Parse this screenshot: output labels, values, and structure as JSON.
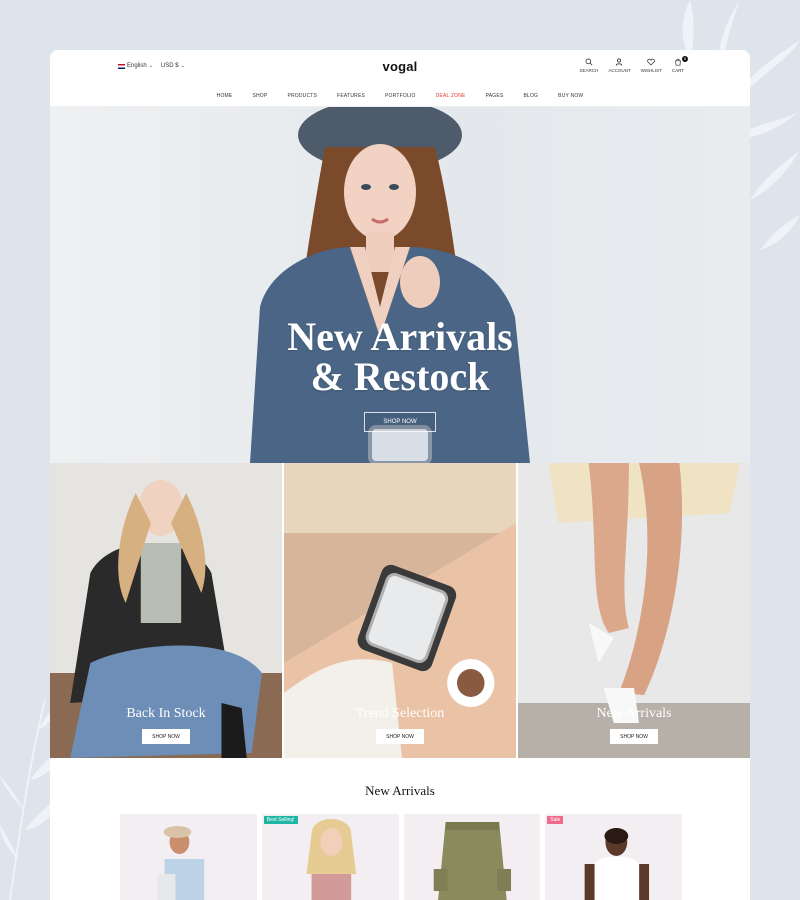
{
  "header": {
    "language": "English",
    "currency": "USD $",
    "logo": "vogal",
    "tools": [
      {
        "label": "SEARCH",
        "icon": "search-icon"
      },
      {
        "label": "ACCOUNT",
        "icon": "user-icon"
      },
      {
        "label": "WISHLIST",
        "icon": "heart-icon"
      },
      {
        "label": "CART",
        "icon": "cart-icon",
        "count": "0"
      }
    ]
  },
  "nav": {
    "items": [
      "HOME",
      "SHOP",
      "PRODUCTS",
      "FEATURES",
      "PORTFOLIO",
      "DEAL ZONE",
      "PAGES",
      "BLOG",
      "BUY NOW"
    ]
  },
  "hero": {
    "title_line1": "New Arrivals",
    "title_line2": "& Restock",
    "button": "SHOP NOW"
  },
  "tiles": [
    {
      "title": "Back In Stock",
      "button": "SHOP NOW"
    },
    {
      "title": "Trend Selection",
      "button": "SHOP NOW"
    },
    {
      "title": "New Arrivals",
      "button": "SHOP NOW"
    }
  ],
  "new_arrivals": {
    "title": "New Arrivals",
    "products": [
      {
        "label": ""
      },
      {
        "label": "Best Selling!"
      },
      {
        "label": ""
      },
      {
        "label": "Sale"
      }
    ]
  },
  "colors": {
    "deal_zone": "#e03a3a",
    "badge_best": "#1fb5a5",
    "badge_sale": "#f06b8b",
    "page_bg": "#dde4ec"
  }
}
